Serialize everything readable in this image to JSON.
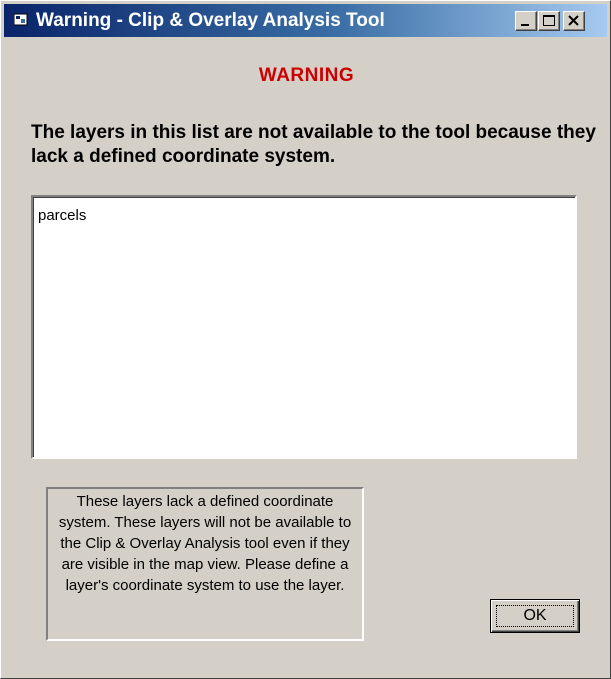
{
  "window": {
    "title": "Warning - Clip & Overlay Analysis Tool",
    "buttons": {
      "minimize": "minimize-icon",
      "maximize": "maximize-icon",
      "close": "close-icon"
    }
  },
  "heading": "WARNING",
  "message": "The layers in this list are not available to the tool because they lack a defined coordinate system.",
  "layers": [
    "parcels"
  ],
  "info_text": "These layers lack a defined coordinate system.  These layers will not be available to the Clip & Overlay Analysis tool even if they are visible in the map view.  Please define a layer's coordinate system to use the layer.",
  "ok_label": "OK",
  "colors": {
    "title_start": "#0a246a",
    "title_end": "#a6caf0",
    "warning": "#cc0000",
    "face": "#d4d0c8"
  }
}
